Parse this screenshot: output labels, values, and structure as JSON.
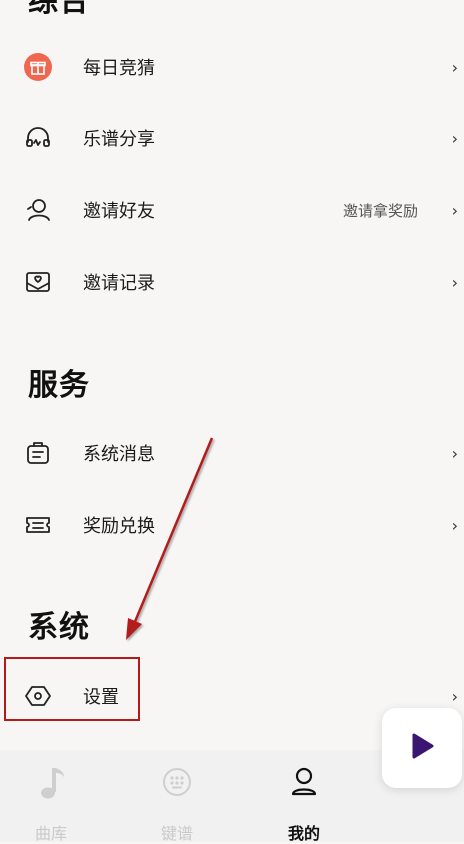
{
  "sections": {
    "general_title": "综合",
    "service_title": "服务",
    "system_title": "系统"
  },
  "general_items": [
    {
      "label": "每日竞猜",
      "icon": "gift-icon"
    },
    {
      "label": "乐谱分享",
      "icon": "headphones-icon"
    },
    {
      "label": "邀请好友",
      "icon": "person-icon",
      "extra": "邀请拿奖励"
    },
    {
      "label": "邀请记录",
      "icon": "envelope-icon"
    }
  ],
  "service_items": [
    {
      "label": "系统消息",
      "icon": "message-bag-icon"
    },
    {
      "label": "奖励兑换",
      "icon": "ticket-icon"
    }
  ],
  "system_items": [
    {
      "label": "设置",
      "icon": "settings-hexagon-icon"
    }
  ],
  "chevron": "›",
  "tabs": [
    {
      "label": "曲库",
      "icon": "music-note-icon"
    },
    {
      "label": "键谱",
      "icon": "keypad-icon"
    },
    {
      "label": "我的",
      "icon": "profile-icon",
      "active": true
    }
  ],
  "colors": {
    "gift_accent": "#f0674f",
    "annotation_red": "#b31b1b",
    "play_purple": "#3a1670"
  }
}
